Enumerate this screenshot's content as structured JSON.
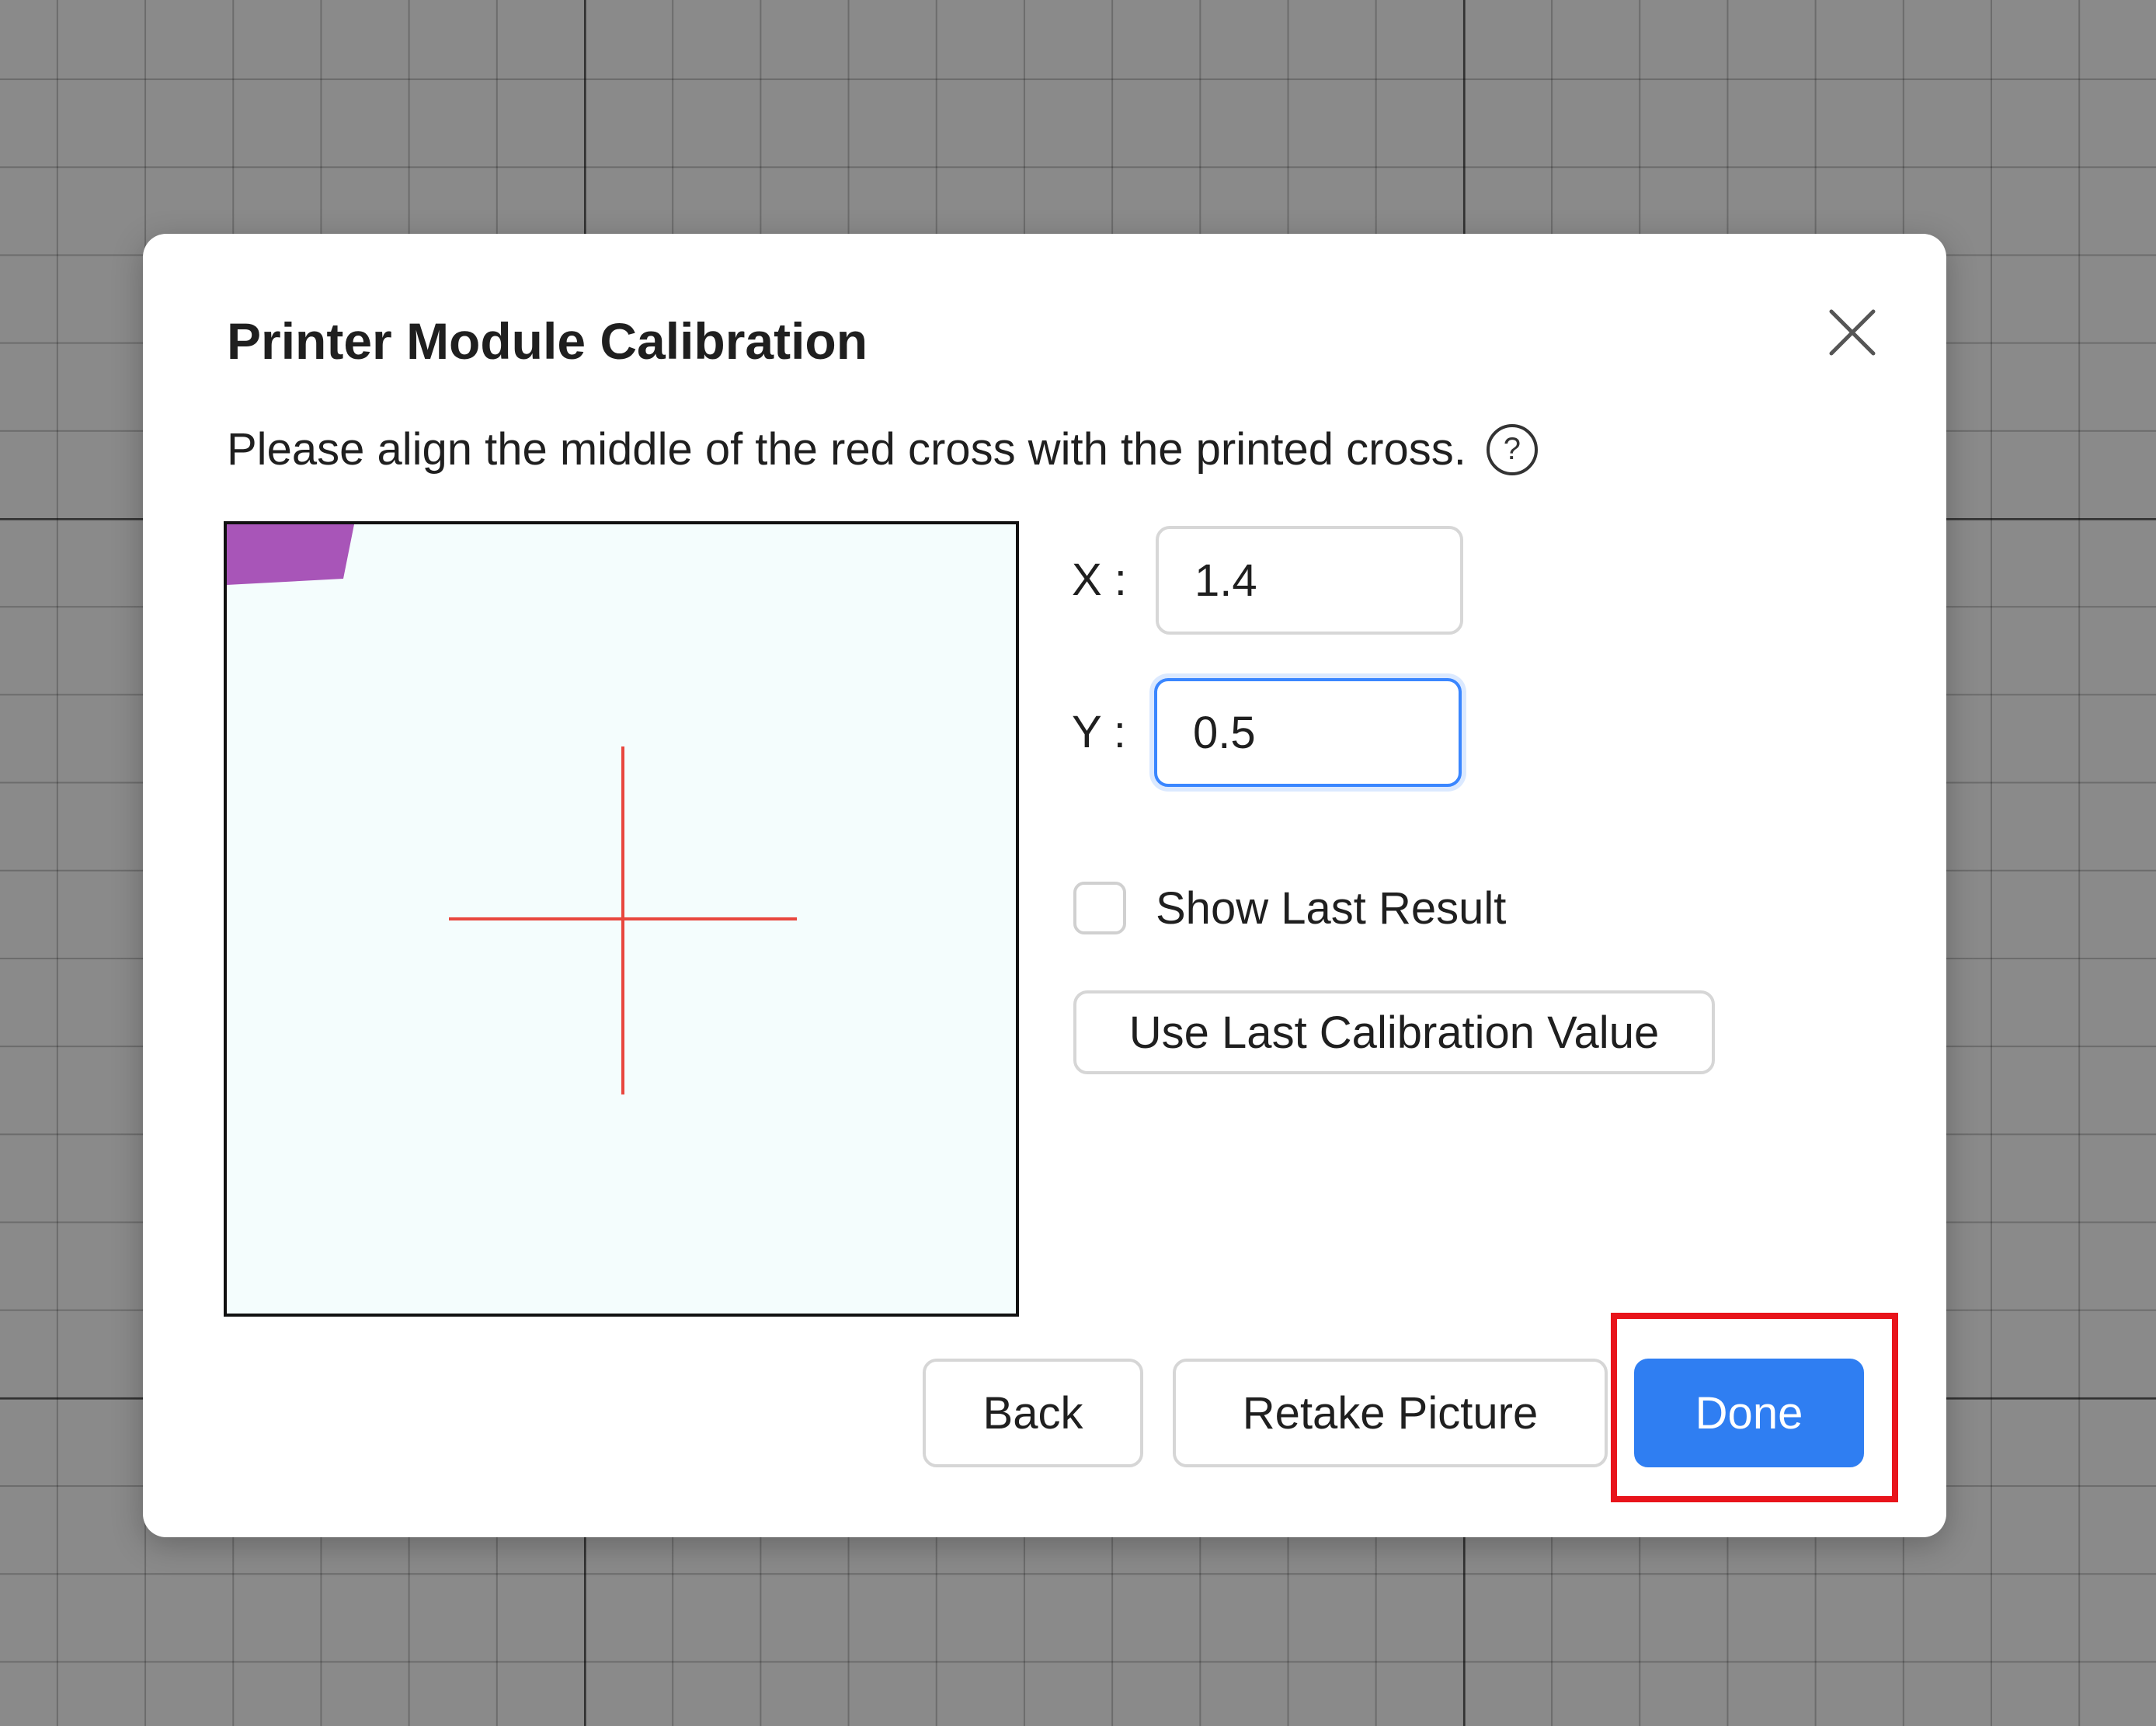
{
  "dialog": {
    "title": "Printer Module Calibration",
    "instruction": "Please align the middle of the red cross with the printed cross.",
    "help_icon_glyph": "?",
    "fields": {
      "x": {
        "label": "X :",
        "value": "1.4"
      },
      "y": {
        "label": "Y :",
        "value": "0.5"
      }
    },
    "show_last_result": {
      "label": "Show Last Result",
      "checked": false
    },
    "use_last_calibration_label": "Use Last Calibration Value",
    "buttons": {
      "back": "Back",
      "retake": "Retake Picture",
      "done": "Done"
    }
  },
  "colors": {
    "primary": "#2f7ef2",
    "cross": "#e8473e",
    "highlight": "#e8141b",
    "printed_blob": "#a855b8"
  },
  "icons": {
    "close": "close-icon",
    "help": "help-icon"
  }
}
